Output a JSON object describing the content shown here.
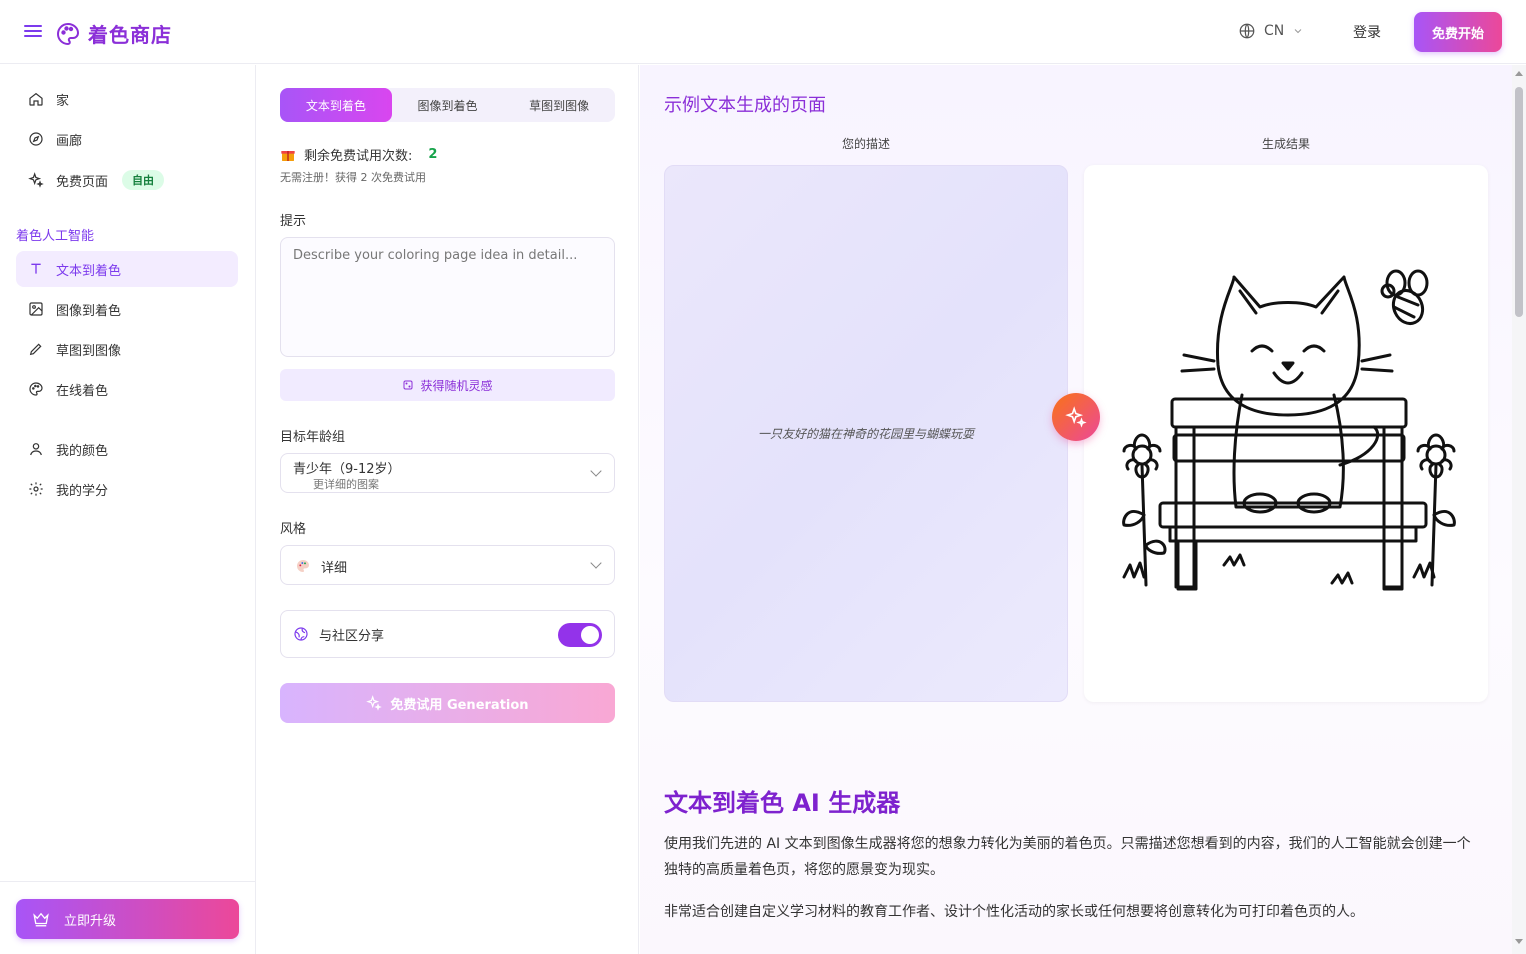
{
  "header": {
    "brand": "着色商店",
    "lang": "CN",
    "login": "登录",
    "start": "免费开始"
  },
  "sidebar": {
    "items": [
      {
        "label": "家"
      },
      {
        "label": "画廊"
      },
      {
        "label": "免费页面",
        "badge": "自由"
      }
    ],
    "section_label": "着色人工智能",
    "ai_items": [
      {
        "label": "文本到着色"
      },
      {
        "label": "图像到着色"
      },
      {
        "label": "草图到图像"
      },
      {
        "label": "在线着色"
      }
    ],
    "account_items": [
      {
        "label": "我的颜色"
      },
      {
        "label": "我的学分"
      }
    ],
    "upgrade": "立即升级"
  },
  "form": {
    "tabs": [
      "文本到着色",
      "图像到着色",
      "草图到图像"
    ],
    "trial_label": "剩余免费试用次数:",
    "trial_count": "2",
    "trial_sub": "无需注册！获得 2 次免费试用",
    "prompt_label": "提示",
    "prompt_placeholder": "Describe your coloring page idea in detail...",
    "random_button": "获得随机灵感",
    "age_label": "目标年龄组",
    "age_value": "青少年（9-12岁）",
    "age_sub": "更详细的图案",
    "style_label": "风格",
    "style_value": "详细",
    "share_label": "与社区分享",
    "share_enabled": true,
    "generate_button": "免费试用 Generation"
  },
  "main": {
    "example_title": "示例文本生成的页面",
    "desc_label": "您的描述",
    "result_label": "生成结果",
    "desc_text": "一只友好的猫在神奇的花园里与蝴蝶玩耍",
    "section_title": "文本到着色 AI 生成器",
    "para1": "使用我们先进的 AI 文本到图像生成器将您的想象力转化为美丽的着色页。只需描述您想看到的内容，我们的人工智能就会创建一个独特的高质量着色页，将您的愿景变为现实。",
    "para2": "非常适合创建自定义学习材料的教育工作者、设计个性化活动的家长或任何想要将创意转化为可打印着色页的人。"
  },
  "colors": {
    "accent": "#8b2fd8",
    "gradient_start": "#a855f7",
    "gradient_end": "#ec4899",
    "success": "#16a34a"
  }
}
